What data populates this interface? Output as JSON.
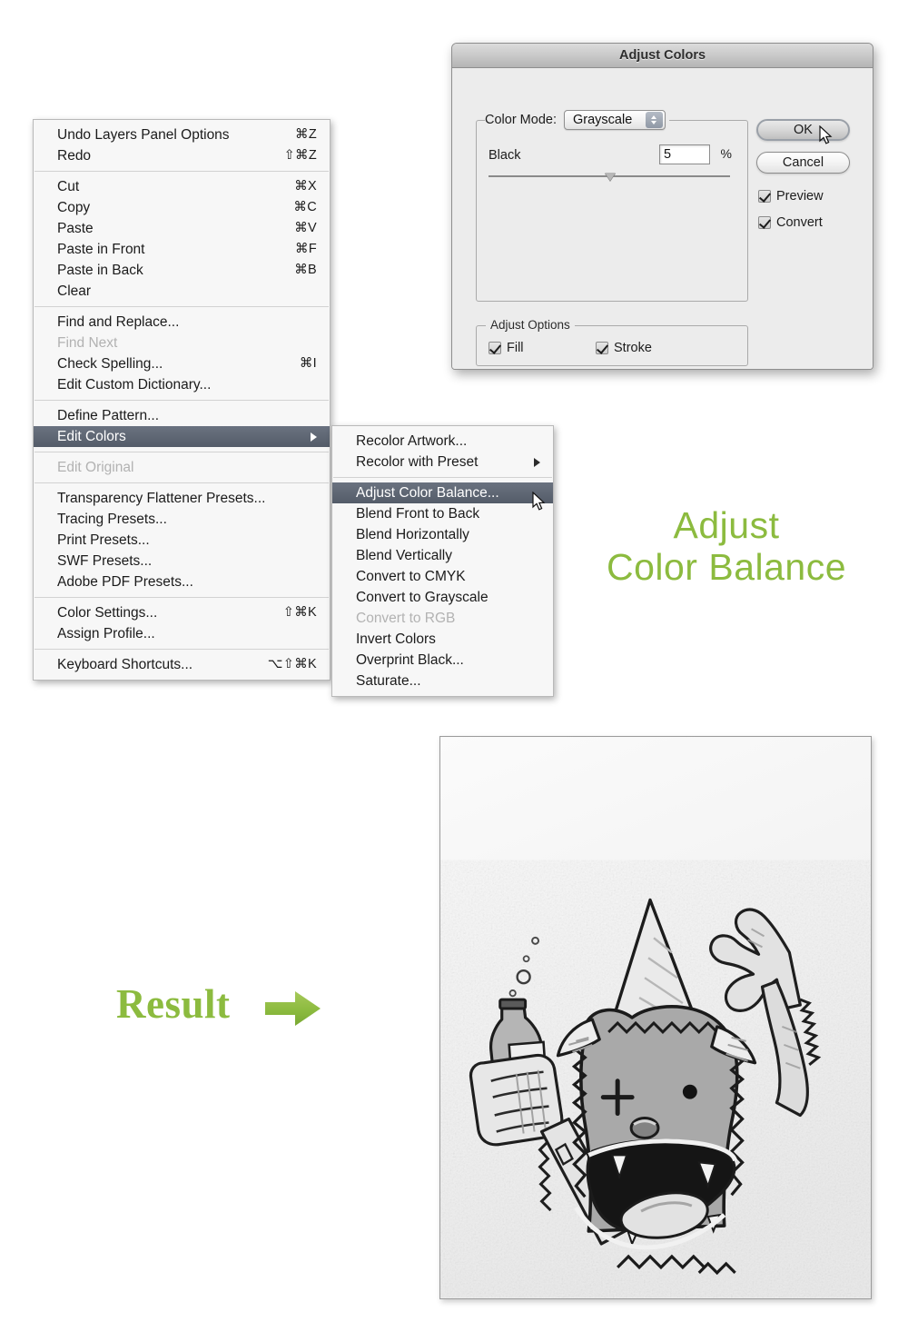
{
  "edit_menu": {
    "name": "Edit menu",
    "groups": [
      [
        {
          "label": "Undo Layers Panel Options",
          "key": "⌘Z",
          "state": "normal"
        },
        {
          "label": "Redo",
          "key": "⇧⌘Z",
          "state": "normal"
        }
      ],
      [
        {
          "label": "Cut",
          "key": "⌘X",
          "state": "normal"
        },
        {
          "label": "Copy",
          "key": "⌘C",
          "state": "normal"
        },
        {
          "label": "Paste",
          "key": "⌘V",
          "state": "normal"
        },
        {
          "label": "Paste in Front",
          "key": "⌘F",
          "state": "normal"
        },
        {
          "label": "Paste in Back",
          "key": "⌘B",
          "state": "normal"
        },
        {
          "label": "Clear",
          "key": "",
          "state": "normal"
        }
      ],
      [
        {
          "label": "Find and Replace...",
          "key": "",
          "state": "normal"
        },
        {
          "label": "Find Next",
          "key": "",
          "state": "disabled"
        },
        {
          "label": "Check Spelling...",
          "key": "⌘I",
          "state": "normal"
        },
        {
          "label": "Edit Custom Dictionary...",
          "key": "",
          "state": "normal"
        }
      ],
      [
        {
          "label": "Define Pattern...",
          "key": "",
          "state": "normal"
        },
        {
          "label": "Edit Colors",
          "key": "",
          "state": "selected",
          "submenu": true
        }
      ],
      [
        {
          "label": "Edit Original",
          "key": "",
          "state": "disabled"
        }
      ],
      [
        {
          "label": "Transparency Flattener Presets...",
          "key": "",
          "state": "normal"
        },
        {
          "label": "Tracing Presets...",
          "key": "",
          "state": "normal"
        },
        {
          "label": "Print Presets...",
          "key": "",
          "state": "normal"
        },
        {
          "label": "SWF Presets...",
          "key": "",
          "state": "normal"
        },
        {
          "label": "Adobe PDF Presets...",
          "key": "",
          "state": "normal"
        }
      ],
      [
        {
          "label": "Color Settings...",
          "key": "⇧⌘K",
          "state": "normal"
        },
        {
          "label": "Assign Profile...",
          "key": "",
          "state": "normal"
        }
      ],
      [
        {
          "label": "Keyboard Shortcuts...",
          "key": "⌥⇧⌘K",
          "state": "normal"
        }
      ]
    ]
  },
  "edit_colors_submenu": {
    "name": "Edit Colors submenu",
    "groups": [
      [
        {
          "label": "Recolor Artwork...",
          "state": "normal"
        },
        {
          "label": "Recolor with Preset",
          "state": "normal",
          "submenu": true
        }
      ],
      [
        {
          "label": "Adjust Color Balance...",
          "state": "selected"
        },
        {
          "label": "Blend Front to Back",
          "state": "normal"
        },
        {
          "label": "Blend Horizontally",
          "state": "normal"
        },
        {
          "label": "Blend Vertically",
          "state": "normal"
        },
        {
          "label": "Convert to CMYK",
          "state": "normal"
        },
        {
          "label": "Convert to Grayscale",
          "state": "normal"
        },
        {
          "label": "Convert to RGB",
          "state": "disabled"
        },
        {
          "label": "Invert Colors",
          "state": "normal"
        },
        {
          "label": "Overprint Black...",
          "state": "normal"
        },
        {
          "label": "Saturate...",
          "state": "normal"
        }
      ]
    ]
  },
  "dialog": {
    "title": "Adjust Colors",
    "color_mode_label": "Color Mode:",
    "color_mode_value": "Grayscale",
    "color_mode_options": [
      "Grayscale"
    ],
    "slider": {
      "label": "Black",
      "value": "5",
      "unit": "%"
    },
    "buttons": {
      "ok": "OK",
      "cancel": "Cancel"
    },
    "checkboxes": {
      "preview": {
        "label": "Preview",
        "checked": true
      },
      "convert": {
        "label": "Convert",
        "checked": true
      },
      "fill": {
        "label": "Fill",
        "checked": true
      },
      "stroke": {
        "label": "Stroke",
        "checked": true
      }
    },
    "adjust_options_title": "Adjust Options"
  },
  "captions": {
    "adjust_line1": "Adjust",
    "adjust_line2": "Color Balance",
    "result": "Result",
    "green": "#8cbb3f"
  },
  "artwork": {
    "name": "grayscale-monster-illustration",
    "description": "Grayscale cartoon monster holding a bottle, mouth open, one arm raised"
  }
}
